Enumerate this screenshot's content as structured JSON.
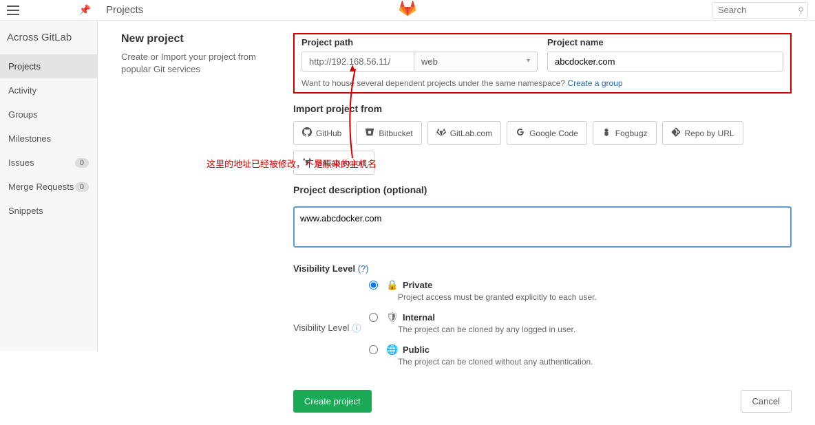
{
  "topbar": {
    "title": "Projects",
    "search_placeholder": "Search"
  },
  "sidebar": {
    "title": "Across GitLab",
    "items": [
      {
        "label": "Projects",
        "badge": null
      },
      {
        "label": "Activity",
        "badge": null
      },
      {
        "label": "Groups",
        "badge": null
      },
      {
        "label": "Milestones",
        "badge": null
      },
      {
        "label": "Issues",
        "badge": "0"
      },
      {
        "label": "Merge Requests",
        "badge": "0"
      },
      {
        "label": "Snippets",
        "badge": null
      }
    ]
  },
  "new_project": {
    "title": "New project",
    "description": "Create or Import your project from popular Git services"
  },
  "form": {
    "path_label": "Project path",
    "path_prefix": "http://192.168.56.11/",
    "namespace_selected": "web",
    "name_label": "Project name",
    "name_value": "abcdocker.com",
    "namespace_note_prefix": "Want to house several dependent projects under the same namespace? ",
    "namespace_note_link": "Create a group",
    "import_label": "Import project from",
    "import_sources": [
      {
        "key": "github",
        "label": "GitHub"
      },
      {
        "key": "bitbucket",
        "label": "Bitbucket"
      },
      {
        "key": "gitlabcom",
        "label": "GitLab.com"
      },
      {
        "key": "googlecode",
        "label": "Google Code"
      },
      {
        "key": "fogbugz",
        "label": "Fogbugz"
      },
      {
        "key": "repourl",
        "label": "Repo by URL"
      },
      {
        "key": "gitlabexport",
        "label": "GitLab export"
      }
    ],
    "description_label": "Project description (optional)",
    "description_value": "www.abcdocker.com",
    "visibility_title": "Visibility Level",
    "visibility_help": "(?)",
    "visibility_label": "Visibility Level",
    "visibility_options": [
      {
        "value": "private",
        "name": "Private",
        "desc": "Project access must be granted explicitly to each user.",
        "checked": true
      },
      {
        "value": "internal",
        "name": "Internal",
        "desc": "The project can be cloned by any logged in user.",
        "checked": false
      },
      {
        "value": "public",
        "name": "Public",
        "desc": "The project can be cloned without any authentication.",
        "checked": false
      }
    ],
    "submit_label": "Create project",
    "cancel_label": "Cancel"
  },
  "annotation": {
    "text": "这里的地址已经被修改，不是原来的主机名"
  }
}
